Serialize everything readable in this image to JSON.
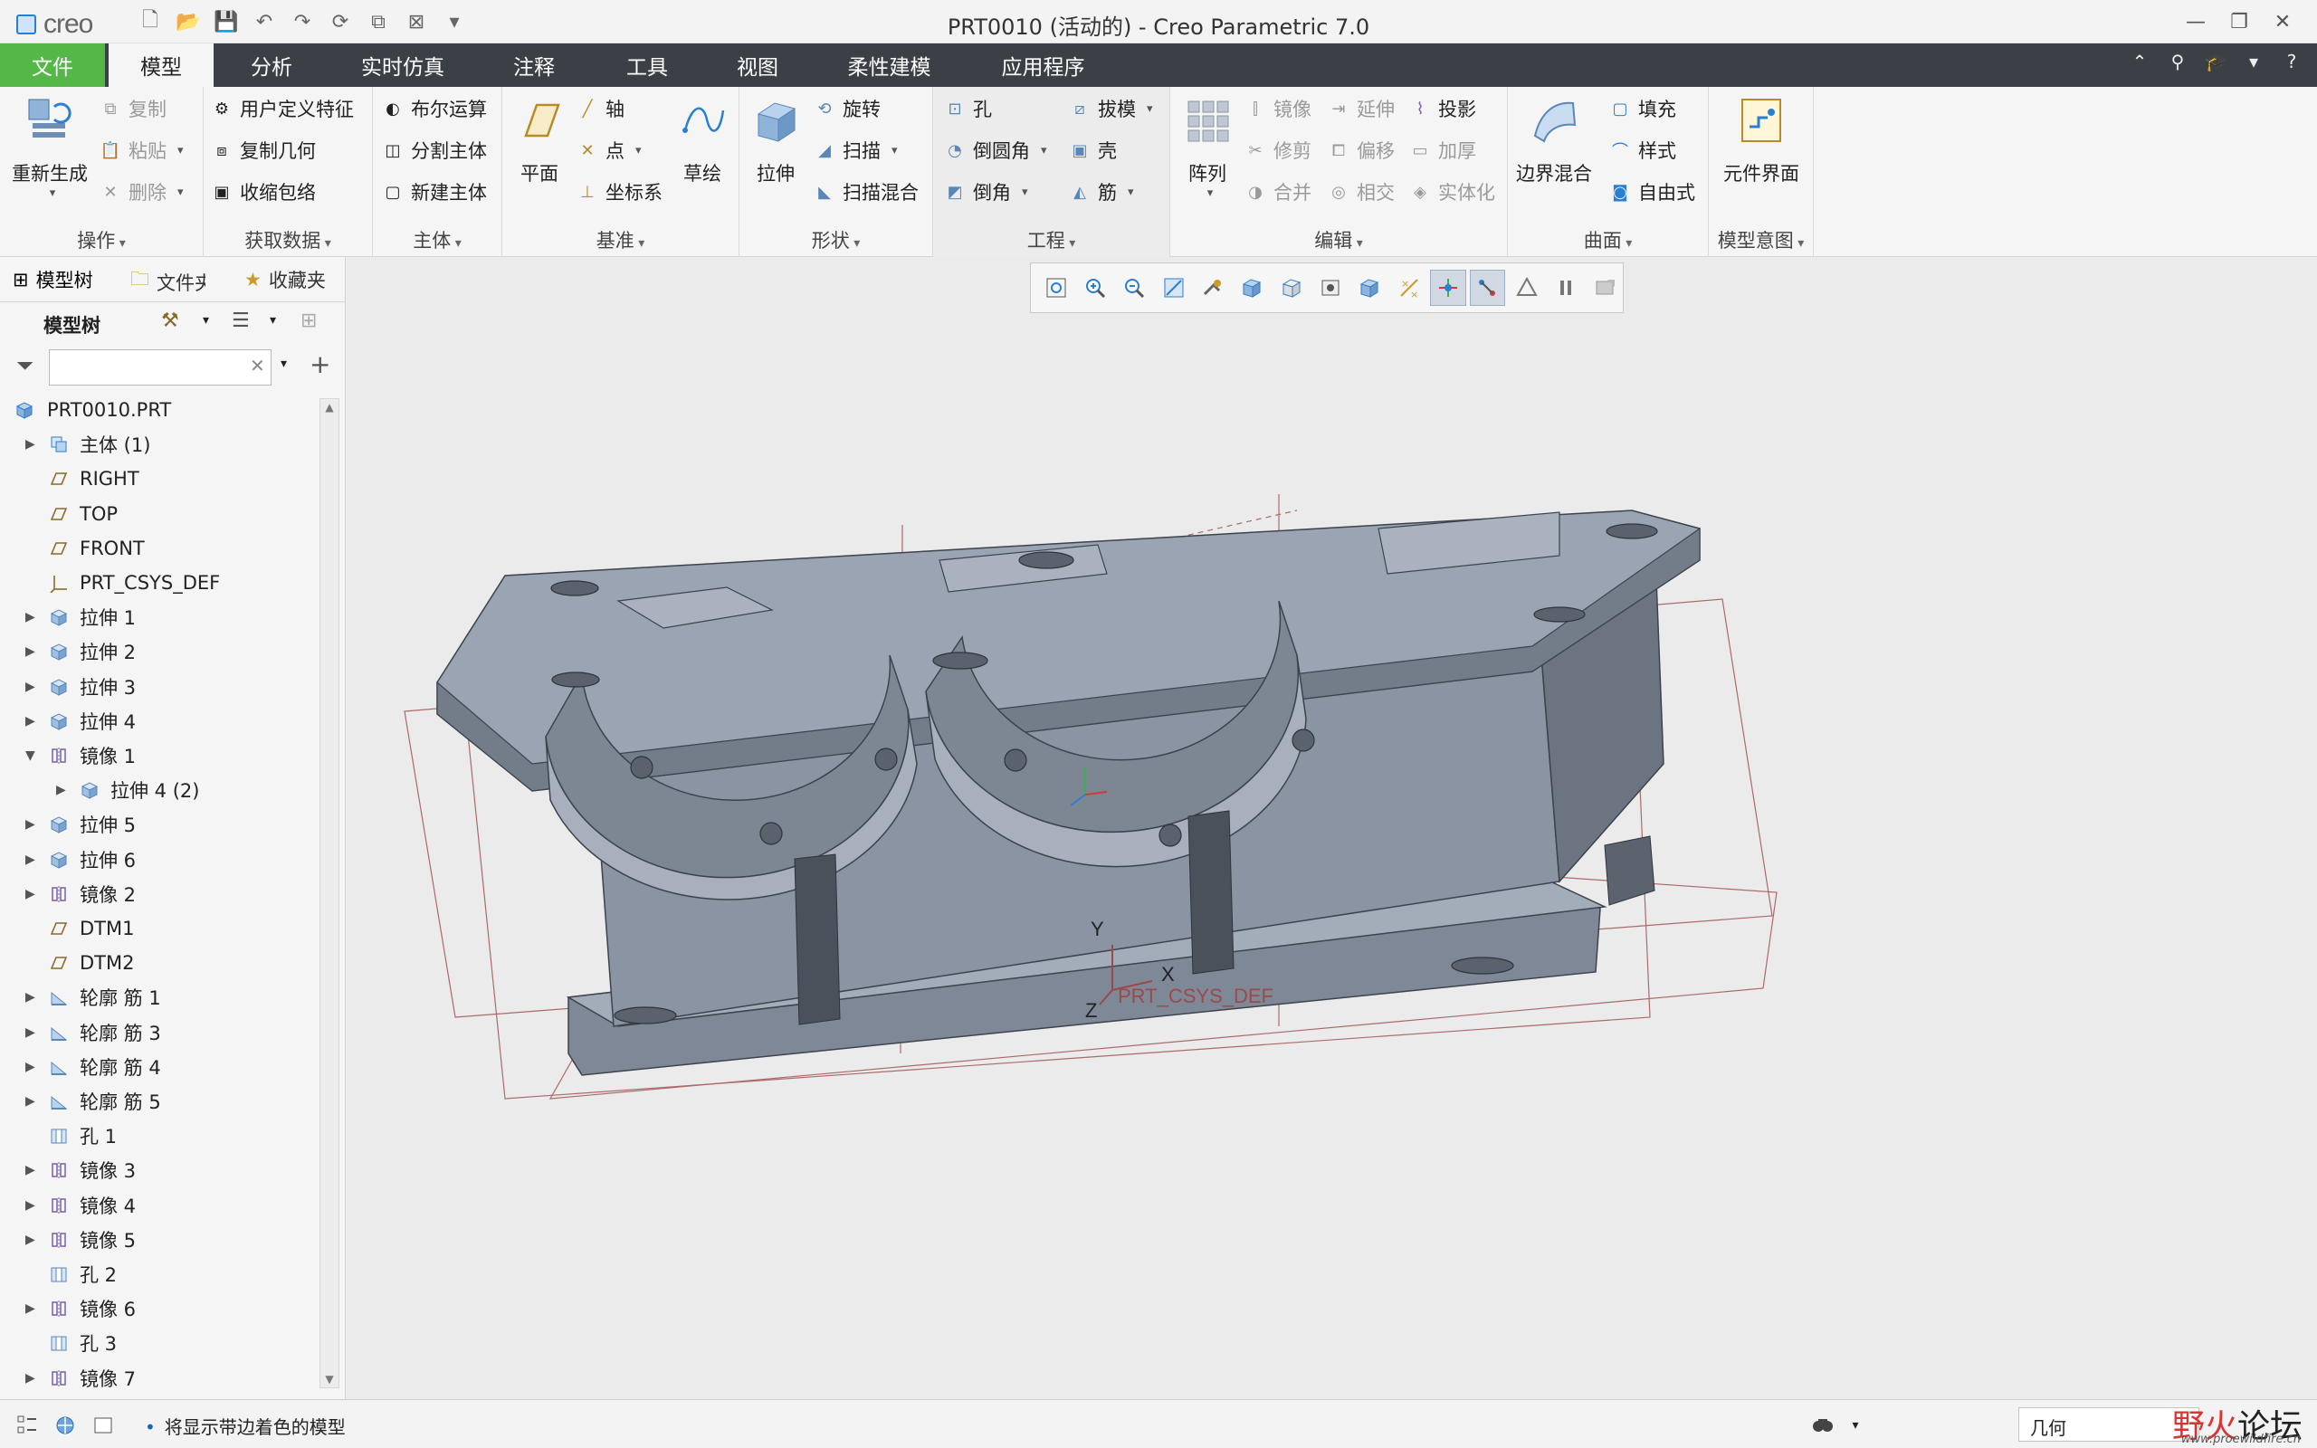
{
  "app": {
    "logo_text": "creo",
    "window_title": "PRT0010 (活动的) - Creo Parametric 7.0"
  },
  "ribbon_tabs": [
    "文件",
    "模型",
    "分析",
    "实时仿真",
    "注释",
    "工具",
    "视图",
    "柔性建模",
    "应用程序"
  ],
  "active_tab": "模型",
  "ribbon": {
    "operations": {
      "label": "操作",
      "regenerate": "重新生成",
      "copy": "复制",
      "paste": "粘贴",
      "delete": "删除"
    },
    "get_data": {
      "label": "获取数据",
      "udf": "用户定义特征",
      "copy_geom": "复制几何",
      "shrinkwrap": "收缩包络"
    },
    "body": {
      "label": "主体",
      "boolean": "布尔运算",
      "split": "分割主体",
      "new_body": "新建主体"
    },
    "datum": {
      "label": "基准",
      "plane": "平面",
      "axis": "轴",
      "point": "点",
      "csys": "坐标系",
      "sketch": "草绘"
    },
    "shapes": {
      "label": "形状",
      "extrude": "拉伸",
      "revolve": "旋转",
      "sweep": "扫描",
      "swept_blend": "扫描混合"
    },
    "engineering": {
      "label": "工程",
      "hole": "孔",
      "round": "倒圆角",
      "chamfer": "倒角",
      "draft": "拔模",
      "shell": "壳",
      "rib": "筋"
    },
    "editing": {
      "label": "编辑",
      "pattern": "阵列",
      "mirror": "镜像",
      "trim": "修剪",
      "merge": "合并",
      "extend": "延伸",
      "offset": "偏移",
      "intersect": "相交",
      "project": "投影",
      "thicken": "加厚",
      "solidify": "实体化"
    },
    "surfaces": {
      "label": "曲面",
      "boundary_blend": "边界混合",
      "fill": "填充",
      "style": "样式",
      "freestyle": "自由式"
    },
    "model_intent": {
      "label": "模型意图",
      "component_interface": "元件界面"
    }
  },
  "left_panel": {
    "tabs": [
      "模型树",
      "文件夹",
      "收藏夹"
    ],
    "tree_title": "模型树",
    "filter_placeholder": "",
    "tree": [
      {
        "label": "PRT0010.PRT",
        "icon": "part-icon",
        "indent": 0,
        "twisty": ""
      },
      {
        "label": "主体 (1)",
        "icon": "body-icon",
        "indent": 1,
        "twisty": "▶"
      },
      {
        "label": "RIGHT",
        "icon": "datum-plane-icon",
        "indent": 1,
        "twisty": ""
      },
      {
        "label": "TOP",
        "icon": "datum-plane-icon",
        "indent": 1,
        "twisty": ""
      },
      {
        "label": "FRONT",
        "icon": "datum-plane-icon",
        "indent": 1,
        "twisty": ""
      },
      {
        "label": "PRT_CSYS_DEF",
        "icon": "csys-icon",
        "indent": 1,
        "twisty": ""
      },
      {
        "label": "拉伸 1",
        "icon": "extrude-icon",
        "indent": 1,
        "twisty": "▶"
      },
      {
        "label": "拉伸 2",
        "icon": "extrude-icon",
        "indent": 1,
        "twisty": "▶"
      },
      {
        "label": "拉伸 3",
        "icon": "extrude-icon",
        "indent": 1,
        "twisty": "▶"
      },
      {
        "label": "拉伸 4",
        "icon": "extrude-icon",
        "indent": 1,
        "twisty": "▶"
      },
      {
        "label": "镜像 1",
        "icon": "mirror-icon",
        "indent": 1,
        "twisty": "▼"
      },
      {
        "label": "拉伸 4 (2)",
        "icon": "extrude-icon",
        "indent": 2,
        "twisty": "▶"
      },
      {
        "label": "拉伸 5",
        "icon": "extrude-icon",
        "indent": 1,
        "twisty": "▶"
      },
      {
        "label": "拉伸 6",
        "icon": "extrude-icon",
        "indent": 1,
        "twisty": "▶"
      },
      {
        "label": "镜像 2",
        "icon": "mirror-icon",
        "indent": 1,
        "twisty": "▶"
      },
      {
        "label": "DTM1",
        "icon": "datum-plane-icon",
        "indent": 1,
        "twisty": ""
      },
      {
        "label": "DTM2",
        "icon": "datum-plane-icon",
        "indent": 1,
        "twisty": ""
      },
      {
        "label": "轮廓 筋 1",
        "icon": "rib-icon",
        "indent": 1,
        "twisty": "▶"
      },
      {
        "label": "轮廓 筋 3",
        "icon": "rib-icon",
        "indent": 1,
        "twisty": "▶"
      },
      {
        "label": "轮廓 筋 4",
        "icon": "rib-icon",
        "indent": 1,
        "twisty": "▶"
      },
      {
        "label": "轮廓 筋 5",
        "icon": "rib-icon",
        "indent": 1,
        "twisty": "▶"
      },
      {
        "label": "孔 1",
        "icon": "hole-icon",
        "indent": 1,
        "twisty": ""
      },
      {
        "label": "镜像 3",
        "icon": "mirror-icon",
        "indent": 1,
        "twisty": "▶"
      },
      {
        "label": "镜像 4",
        "icon": "mirror-icon",
        "indent": 1,
        "twisty": "▶"
      },
      {
        "label": "镜像 5",
        "icon": "mirror-icon",
        "indent": 1,
        "twisty": "▶"
      },
      {
        "label": "孔 2",
        "icon": "hole-icon",
        "indent": 1,
        "twisty": ""
      },
      {
        "label": "镜像 6",
        "icon": "mirror-icon",
        "indent": 1,
        "twisty": "▶"
      },
      {
        "label": "孔 3",
        "icon": "hole-icon",
        "indent": 1,
        "twisty": ""
      },
      {
        "label": "镜像 7",
        "icon": "mirror-icon",
        "indent": 1,
        "twisty": "▶"
      }
    ]
  },
  "graphics": {
    "csys_labels": {
      "y": "Y",
      "x": "X",
      "z": "Z",
      "name": "PRT_CSYS_DEF"
    },
    "view_toolbar_icons": [
      "refit-icon",
      "zoom-in-icon",
      "zoom-out-icon",
      "repaint-icon",
      "pan-icon",
      "display-style-icon",
      "saved-orientations-icon",
      "view-manager-icon",
      "perspective-icon",
      "datum-display-icon",
      "spin-center-icon",
      "annotation-display-icon",
      "appearance-icon",
      "pause-icon",
      "regen-icon"
    ]
  },
  "status": {
    "message": "将显示带边着色的模型",
    "selection_filter": "几何"
  },
  "watermark": {
    "brand_red": "野火",
    "brand_rest": "论坛",
    "url": "www.proewildfire.cn"
  },
  "colors": {
    "file_tab": "#53b848",
    "tab_bar": "#3b4046",
    "model_fill": "#8e98a6",
    "datum_plane": "#9b4a4a"
  }
}
